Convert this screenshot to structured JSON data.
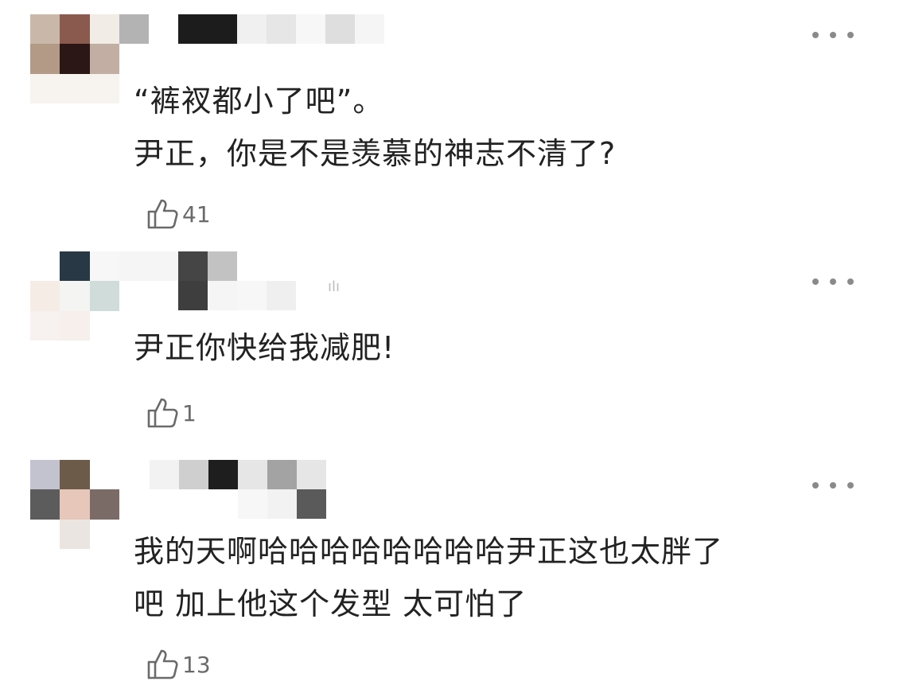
{
  "comments": [
    {
      "lines": [
        "“裤衩都小了吧”。",
        "尹正，你是不是羡慕的神志不清了?"
      ],
      "likes": "41",
      "avatar_colors": [
        "#c9b8aa",
        "#8a5a4f",
        "#f1ece6",
        "#b39a86",
        "#2a1716",
        "#c2aea3",
        "#f7f3ee",
        "#f7f4ef",
        "#f7f4f0"
      ],
      "name_colors": [
        "#b3b3b3",
        "#ffffff",
        "#ffffff",
        "#ffffff",
        "#1c1c1c",
        "#ffffff",
        "#1c1c1c",
        "#ffffff",
        "#f0f0f0",
        "#ffffff",
        "#e6e6e6",
        "#ffffff",
        "#f7f7f7",
        "#ffffff",
        "#dedede",
        "#ffffff",
        "#f5f5f5",
        "#ffffff"
      ]
    },
    {
      "lines": [
        "尹正你快给我减肥!"
      ],
      "likes": "1",
      "avatar_colors": [
        "#ffffff",
        "#283845",
        "#f7f7f7",
        "#f6ece6",
        "#f4f4f2",
        "#cfdcda",
        "#f7f2ef",
        "#f6efeb",
        "#ffffff"
      ],
      "name_colors": [
        "#f5f5f5",
        "#ffffff",
        "#f5f5f5",
        "#ffffff",
        "#454545",
        "#3e3e3e",
        "#c2c2c2",
        "#f5f5f5",
        "#ffffff",
        "#f7f7f7",
        "#ffffff",
        "#efefef"
      ],
      "name_suffix": "ılı"
    },
    {
      "lines": [
        "我的天啊哈哈哈哈哈哈哈哈尹正这也太胖了",
        "吧 加上他这个发型 太可怕了"
      ],
      "likes": "13",
      "avatar_colors": [
        "#c3c3d0",
        "#6d5b4a",
        "#ffffff",
        "#5c5c5c",
        "#e6c7b9",
        "#7b6b66",
        "#ffffff",
        "#ebe5e1",
        "#ffffff"
      ],
      "name_colors": [
        "#f2f2f2",
        "#ffffff",
        "#cfcfcf",
        "#ffffff",
        "#1e1e1e",
        "#ffffff",
        "#e6e6e6",
        "#f7f7f7",
        "#a3a3a3",
        "#f2f2f2",
        "#e6e6e6",
        "#5a5a5a"
      ]
    }
  ]
}
